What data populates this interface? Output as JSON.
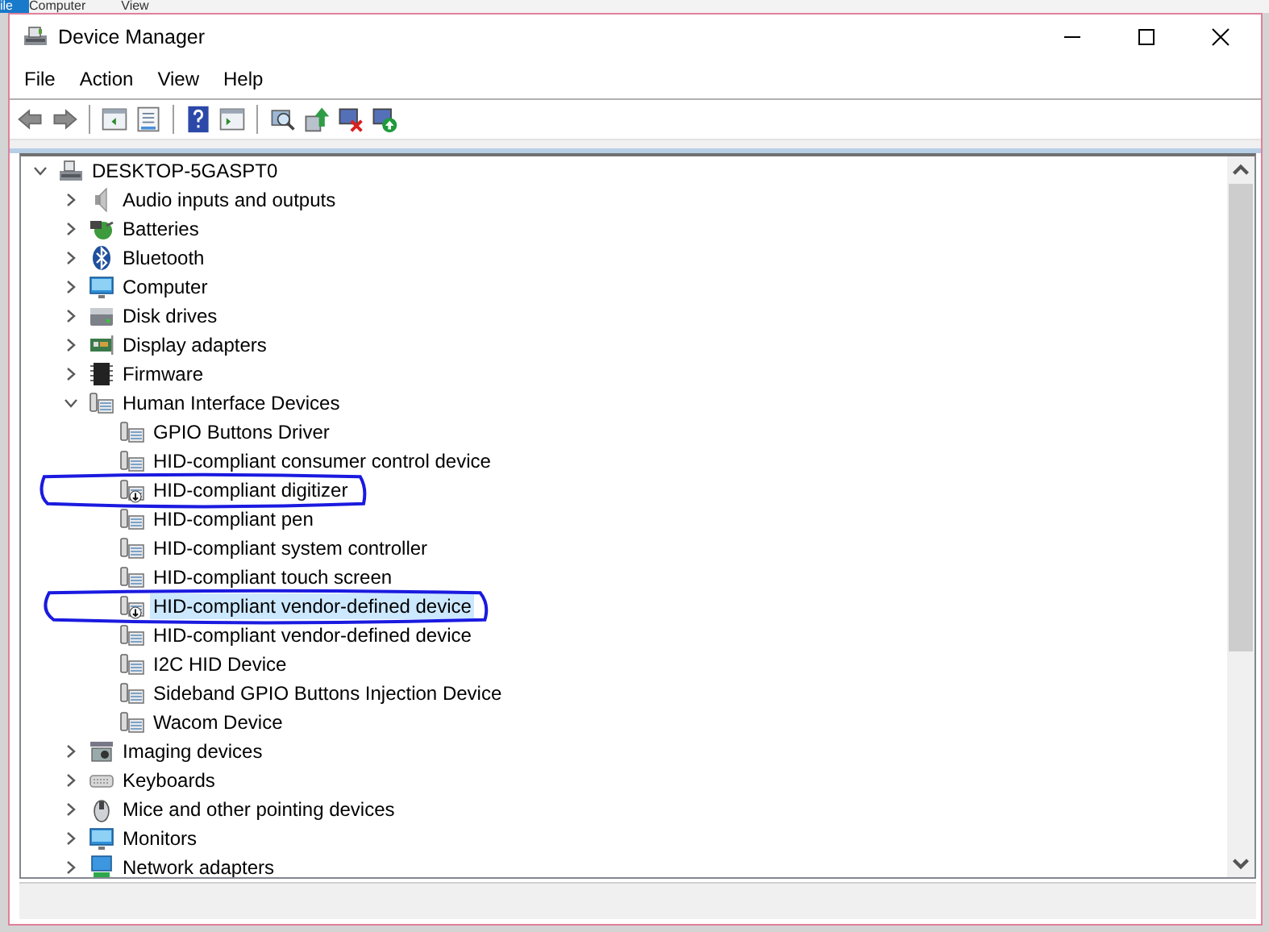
{
  "background_ribbon": {
    "tabs": [
      {
        "label": "ile",
        "selected": true
      },
      {
        "label": "Computer",
        "selected": false
      },
      {
        "label": "View",
        "selected": false
      }
    ]
  },
  "window": {
    "title": "Device Manager"
  },
  "menu": [
    "File",
    "Action",
    "View",
    "Help"
  ],
  "tree": {
    "label": "DESKTOP-5GASPT0",
    "kind": "pc",
    "expanded": true,
    "selected": false,
    "children": [
      {
        "label": "Audio inputs and outputs",
        "kind": "audio",
        "expanded": false,
        "selected": false
      },
      {
        "label": "Batteries",
        "kind": "battery",
        "expanded": false,
        "selected": false
      },
      {
        "label": "Bluetooth",
        "kind": "bluetooth",
        "expanded": false,
        "selected": false
      },
      {
        "label": "Computer",
        "kind": "computer",
        "expanded": false,
        "selected": false
      },
      {
        "label": "Disk drives",
        "kind": "disk",
        "expanded": false,
        "selected": false
      },
      {
        "label": "Display adapters",
        "kind": "display",
        "expanded": false,
        "selected": false
      },
      {
        "label": "Firmware",
        "kind": "firmware",
        "expanded": false,
        "selected": false
      },
      {
        "label": "Human Interface Devices",
        "kind": "hid",
        "expanded": true,
        "selected": false,
        "children": [
          {
            "label": "GPIO Buttons Driver",
            "kind": "hid",
            "selected": false,
            "disabled": false,
            "circled": false
          },
          {
            "label": "HID-compliant consumer control device",
            "kind": "hid",
            "selected": false,
            "disabled": false,
            "circled": false
          },
          {
            "label": "HID-compliant digitizer",
            "kind": "hid",
            "selected": false,
            "disabled": true,
            "circled": true
          },
          {
            "label": "HID-compliant pen",
            "kind": "hid",
            "selected": false,
            "disabled": false,
            "circled": false
          },
          {
            "label": "HID-compliant system controller",
            "kind": "hid",
            "selected": false,
            "disabled": false,
            "circled": false
          },
          {
            "label": "HID-compliant touch screen",
            "kind": "hid",
            "selected": false,
            "disabled": false,
            "circled": false
          },
          {
            "label": "HID-compliant vendor-defined device",
            "kind": "hid",
            "selected": true,
            "disabled": true,
            "circled": true
          },
          {
            "label": "HID-compliant vendor-defined device",
            "kind": "hid",
            "selected": false,
            "disabled": false,
            "circled": false
          },
          {
            "label": "I2C HID Device",
            "kind": "hid",
            "selected": false,
            "disabled": false,
            "circled": false
          },
          {
            "label": "Sideband GPIO Buttons Injection Device",
            "kind": "hid",
            "selected": false,
            "disabled": false,
            "circled": false
          },
          {
            "label": "Wacom Device",
            "kind": "hid",
            "selected": false,
            "disabled": false,
            "circled": false
          }
        ]
      },
      {
        "label": "Imaging devices",
        "kind": "imaging",
        "expanded": false,
        "selected": false
      },
      {
        "label": "Keyboards",
        "kind": "keyboard",
        "expanded": false,
        "selected": false
      },
      {
        "label": "Mice and other pointing devices",
        "kind": "mouse",
        "expanded": false,
        "selected": false
      },
      {
        "label": "Monitors",
        "kind": "monitor",
        "expanded": false,
        "selected": false
      },
      {
        "label": "Network adapters",
        "kind": "network",
        "expanded": false,
        "selected": false
      }
    ]
  }
}
